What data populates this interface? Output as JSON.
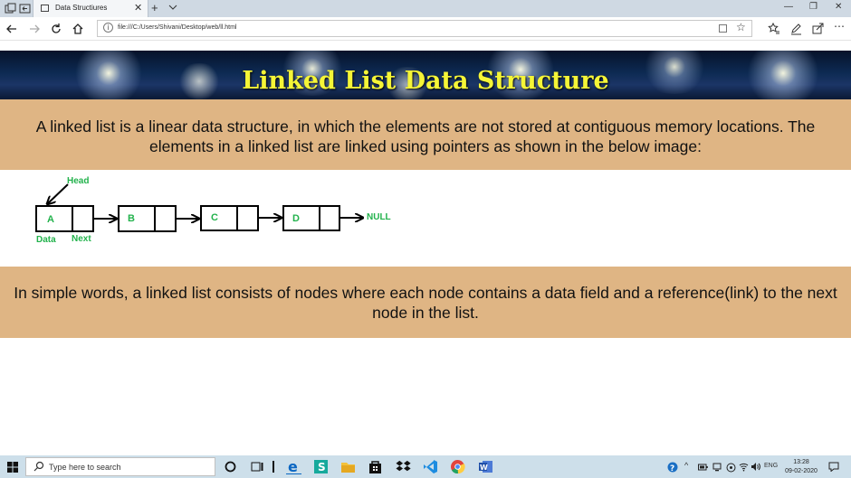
{
  "browser": {
    "tab_title": "Data Structiures",
    "url": "file:///C:/Users/Shivani/Desktop/web/ll.html",
    "close_glyph": "✕",
    "new_tab_glyph": "+",
    "window_buttons": {
      "minimize": "—",
      "restore": "❐",
      "close": "✕"
    }
  },
  "page": {
    "title": "Linked List Data Structure",
    "intro": "A linked list is a linear data structure, in which the elements are not stored at contiguous memory locations. The elements in a linked list are linked using pointers as shown in the below image:",
    "summary": "In simple words, a linked list consists of nodes where each node contains a data field and a reference(link) to the next node in the list."
  },
  "diagram": {
    "head_label": "Head",
    "null_label": "NULL",
    "data_label": "Data",
    "next_label": "Next",
    "nodes": [
      "A",
      "B",
      "C",
      "D"
    ],
    "label_color": "#22b24c"
  },
  "taskbar": {
    "search_placeholder": "Type here to search",
    "tray_lang": "ENG",
    "time": "13:28",
    "date": "09-02-2020"
  },
  "colors": {
    "tan_band": "#dfb584",
    "title_yellow": "#f5f537",
    "banner_navy": "#0d2a52"
  }
}
